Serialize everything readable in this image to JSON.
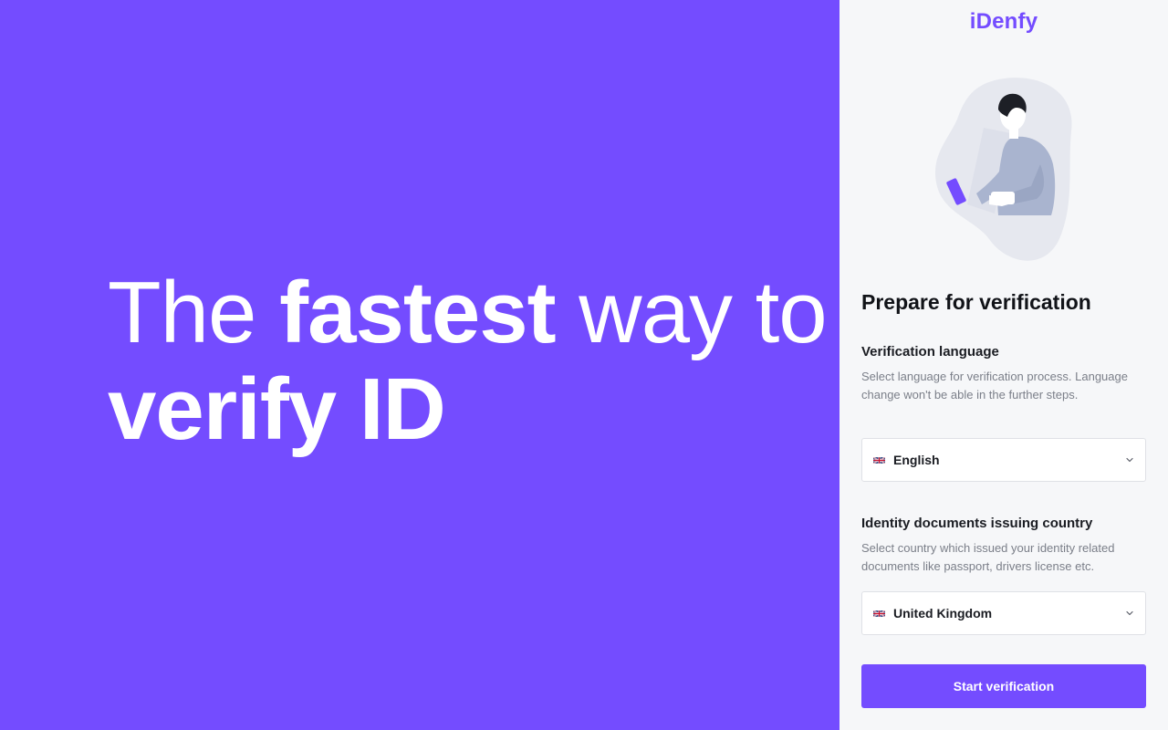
{
  "hero": {
    "line1_light_a": "The ",
    "line1_bold": "fastest",
    "line1_light_b": " way to",
    "line2_bold": "verify ID"
  },
  "brand": {
    "logo_text": "iDenfy",
    "accent_color": "#744cff"
  },
  "form": {
    "title": "Prepare for verification",
    "language": {
      "label": "Verification language",
      "description": "Select language for verification process. Language change won't be able in the further steps.",
      "selected": "English",
      "flag_icon": "uk-flag-icon"
    },
    "country": {
      "label": "Identity documents issuing country",
      "description": "Select country which issued your identity related documents like passport, drivers license etc.",
      "selected": "United Kingdom",
      "flag_icon": "uk-flag-icon"
    },
    "submit_label": "Start verification"
  }
}
